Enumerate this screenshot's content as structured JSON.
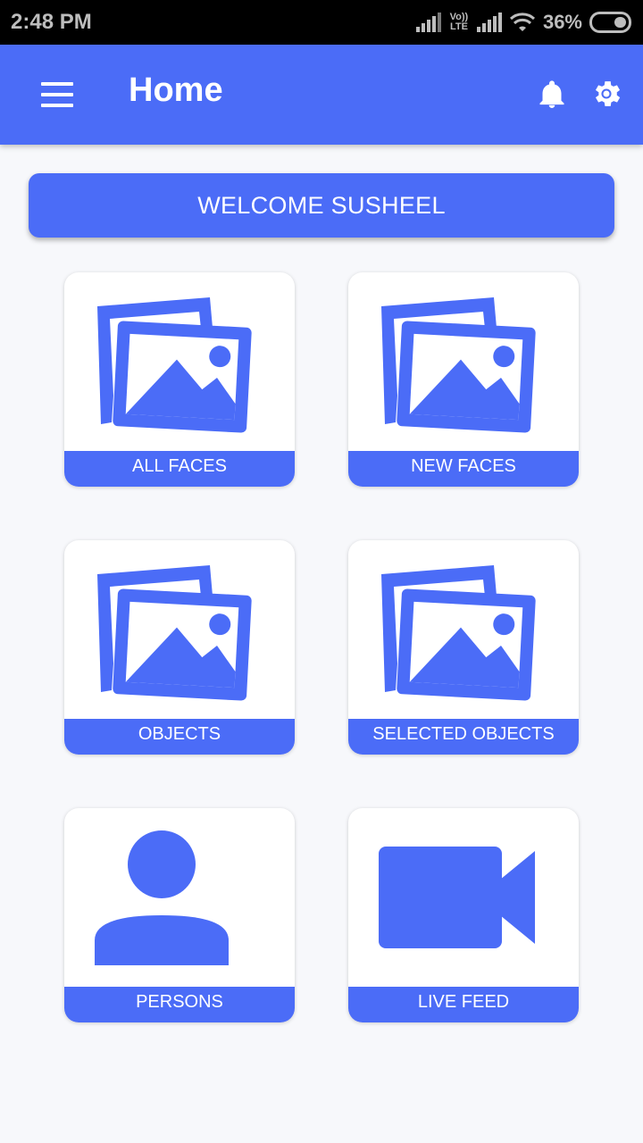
{
  "status_bar": {
    "time": "2:48 PM",
    "lte_top": "Vo))",
    "lte_bottom": "LTE",
    "battery": "36%"
  },
  "app_bar": {
    "title": "Home",
    "menu_icon": "hamburger-menu-icon",
    "notification_icon": "bell-icon",
    "settings_icon": "gear-icon"
  },
  "welcome": {
    "text": "WELCOME SUSHEEL"
  },
  "tiles": [
    {
      "label": "ALL FACES",
      "icon": "image-gallery-icon"
    },
    {
      "label": "NEW FACES",
      "icon": "image-gallery-icon"
    },
    {
      "label": "OBJECTS",
      "icon": "image-gallery-icon"
    },
    {
      "label": "SELECTED OBJECTS",
      "icon": "image-gallery-icon"
    },
    {
      "label": "PERSONS",
      "icon": "person-icon"
    },
    {
      "label": "LIVE FEED",
      "icon": "video-camera-icon"
    }
  ],
  "colors": {
    "primary": "#4b6cf7",
    "background": "#f7f8fb"
  }
}
